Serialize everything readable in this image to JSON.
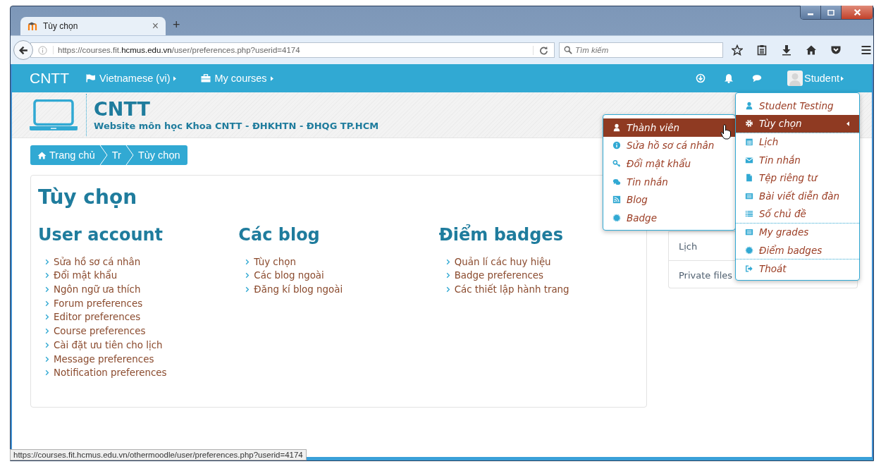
{
  "browser": {
    "tab": {
      "title": "Tùy chọn",
      "close": "×"
    },
    "new_tab": "+",
    "address": {
      "prefix": "https://courses.fit.",
      "domain": "hcmus.edu.vn",
      "path": "/user/preferences.php?userid=4174"
    },
    "search": {
      "placeholder": "Tìm kiếm"
    }
  },
  "navbar": {
    "brand": "CNTT",
    "items": [
      {
        "label": "Vietnamese (vi)",
        "kind": "language"
      },
      {
        "label": "My courses",
        "kind": "courses"
      }
    ],
    "user": "Student"
  },
  "header": {
    "title": "CNTT",
    "subtitle": "Website môn học Khoa CNTT - ĐHKHTN - ĐHQG TP.HCM"
  },
  "breadcrumb": [
    {
      "label": "Trang chủ",
      "kind": "home"
    },
    {
      "label": "Tr",
      "kind": "link"
    },
    {
      "label": "Tùy chọn",
      "kind": "link"
    }
  ],
  "page": {
    "title": "Tùy chọn",
    "sections": [
      {
        "heading": "User account",
        "links": [
          "Sửa hồ sơ cá nhân",
          "Đổi mật khẩu",
          "Ngôn ngữ ưa thích",
          "Forum preferences",
          "Editor preferences",
          "Course preferences",
          "Cài đặt ưu tiên cho lịch",
          "Message preferences",
          "Notification preferences"
        ]
      },
      {
        "heading": "Các blog",
        "links": [
          "Tùy chọn",
          "Các blog ngoài",
          "Đăng kí blog ngoài"
        ]
      },
      {
        "heading": "Điểm badges",
        "links": [
          "Quản lí các huy hiệu",
          "Badge preferences",
          "Các thiết lập hành trang"
        ]
      }
    ]
  },
  "side_block": {
    "items": [
      "Lịch",
      "Private files"
    ]
  },
  "user_menu": {
    "items": [
      {
        "label": "Student Testing",
        "kind": "user",
        "selected": false,
        "expanded": false,
        "group_start": false
      },
      {
        "label": "Tùy chọn",
        "kind": "gear",
        "selected": true,
        "expanded": true,
        "group_start": false
      },
      {
        "label": "Lịch",
        "kind": "calendar",
        "selected": false,
        "expanded": false,
        "group_start": true
      },
      {
        "label": "Tin nhắn",
        "kind": "mail",
        "selected": false,
        "expanded": false,
        "group_start": false
      },
      {
        "label": "Tệp riêng tư",
        "kind": "file",
        "selected": false,
        "expanded": false,
        "group_start": false
      },
      {
        "label": "Bài viết diễn đàn",
        "kind": "table",
        "selected": false,
        "expanded": false,
        "group_start": false
      },
      {
        "label": "Số chủ đề",
        "kind": "list",
        "selected": false,
        "expanded": false,
        "group_start": false
      },
      {
        "label": "My grades",
        "kind": "table",
        "selected": false,
        "expanded": false,
        "group_start": true
      },
      {
        "label": "Điểm badges",
        "kind": "badge",
        "selected": false,
        "expanded": false,
        "group_start": false
      },
      {
        "label": "Thoát",
        "kind": "logout",
        "selected": false,
        "expanded": false,
        "group_start": true
      }
    ]
  },
  "submenu": {
    "items": [
      {
        "label": "Thành viên",
        "kind": "user",
        "selected": true
      },
      {
        "label": "Sửa hồ sơ cá nhân",
        "kind": "info",
        "selected": false
      },
      {
        "label": "Đổi mật khẩu",
        "kind": "key",
        "selected": false
      },
      {
        "label": "Tin nhắn",
        "kind": "chat",
        "selected": false
      },
      {
        "label": "Blog",
        "kind": "rss",
        "selected": false
      },
      {
        "label": "Badge",
        "kind": "badge",
        "selected": false
      }
    ]
  },
  "status_url": "https://courses.fit.hcmus.edu.vn/othermoodle/user/preferences.php?userid=4174"
}
